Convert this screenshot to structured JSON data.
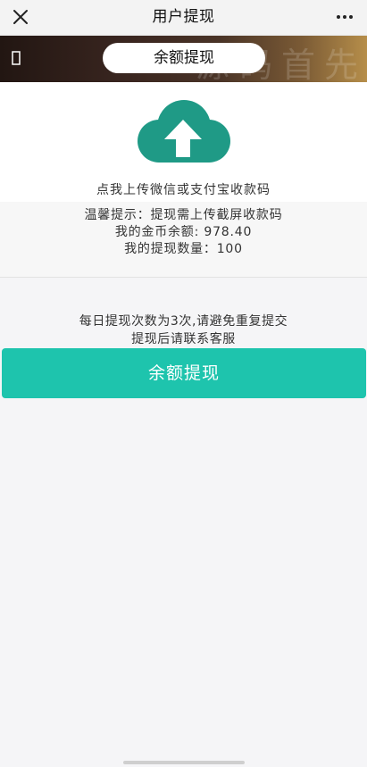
{
  "nav": {
    "title": "用户提现",
    "close_icon": "close-icon",
    "more_icon": "more-dots-icon"
  },
  "banner": {
    "pill_label": "余额提现",
    "watermark": "源码首先",
    "back_icon": "back-arrow-icon"
  },
  "upload": {
    "icon": "cloud-upload-icon",
    "label": "点我上传微信或支付宝收款码"
  },
  "info": {
    "tip": "温馨提示：提现需上传截屏收款码",
    "balance": "我的金币余额: 978.40",
    "count": "我的提现数量：100"
  },
  "notice": {
    "line1": "每日提现次数为3次,请避免重复提交",
    "line2": "提现后请联系客服"
  },
  "action": {
    "label": "余额提现"
  },
  "colors": {
    "accent": "#1ec4ad",
    "cloud": "#1f9a86"
  }
}
